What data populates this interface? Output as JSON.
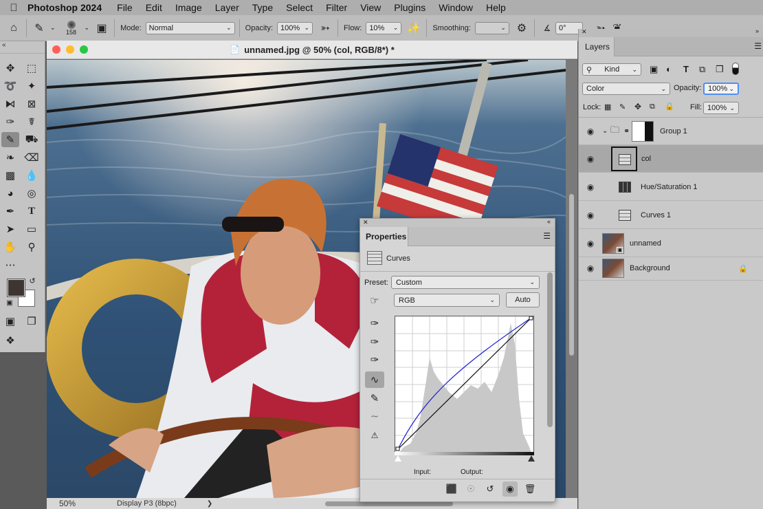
{
  "menubar": {
    "app_name": "Photoshop 2024",
    "items": [
      "File",
      "Edit",
      "Image",
      "Layer",
      "Type",
      "Select",
      "Filter",
      "View",
      "Plugins",
      "Window",
      "Help"
    ]
  },
  "options_bar": {
    "brush_size": "158",
    "mode_label": "Mode:",
    "mode_value": "Normal",
    "opacity_label": "Opacity:",
    "opacity_value": "100%",
    "flow_label": "Flow:",
    "flow_value": "10%",
    "smoothing_label": "Smoothing:",
    "smoothing_value": "",
    "angle_value": "0°"
  },
  "document": {
    "title": "unnamed.jpg @ 50% (col, RGB/8*) *",
    "zoom": "50%",
    "profile": "Display P3 (8bpc)"
  },
  "properties": {
    "tab": "Properties",
    "type_label": "Curves",
    "preset_label": "Preset:",
    "preset_value": "Custom",
    "channel_value": "RGB",
    "auto_label": "Auto",
    "input_label": "Input:",
    "output_label": "Output:"
  },
  "layers": {
    "tab": "Layers",
    "kind_value": "Kind",
    "blend_value": "Color",
    "opacity_label": "Opacity:",
    "opacity_value": "100%",
    "lock_label": "Lock:",
    "fill_label": "Fill:",
    "fill_value": "100%",
    "items": [
      {
        "name": "Group 1"
      },
      {
        "name": "col"
      },
      {
        "name": "Hue/Saturation 1"
      },
      {
        "name": "Curves 1"
      },
      {
        "name": "unnamed"
      },
      {
        "name": "Background"
      }
    ]
  },
  "colors": {
    "foreground": "#3e3431",
    "background": "#ffffff",
    "curve_color": "#1a1ad6"
  }
}
